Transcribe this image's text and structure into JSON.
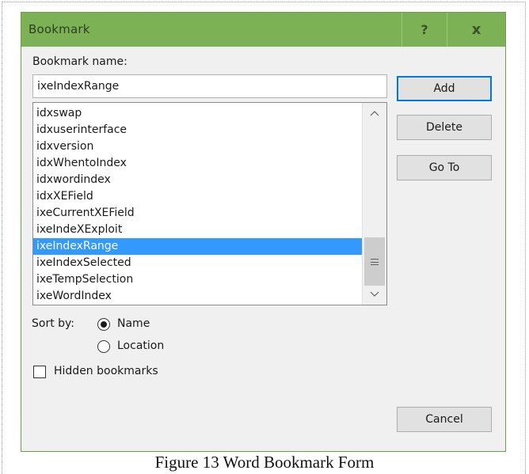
{
  "dialog": {
    "title": "Bookmark",
    "help_label": "?",
    "close_label": "x"
  },
  "bookmark_name_label": "Bookmark name:",
  "bookmark_name_value": "ixeIndexRange",
  "bookmarks": [
    "idxswap",
    "idxuserinterface",
    "idxversion",
    "idxWhentoIndex",
    "idxwordindex",
    "idxXEField",
    "ixeCurrentXEField",
    "ixeIndeXExploit",
    "ixeIndexRange",
    "ixeIndexSelected",
    "ixeTempSelection",
    "ixeWordIndex"
  ],
  "selected_bookmark": "ixeIndexRange",
  "buttons": {
    "add": "Add",
    "delete": "Delete",
    "goto": "Go To",
    "cancel": "Cancel"
  },
  "sort": {
    "label": "Sort by:",
    "options": [
      "Name",
      "Location"
    ],
    "selected": "Name"
  },
  "hidden_bookmarks": {
    "label": "Hidden bookmarks",
    "checked": false
  },
  "caption": "Figure 13 Word Bookmark Form",
  "colors": {
    "titlebar": "#7cb255",
    "selection": "#3399ff",
    "default_button_border": "#0078d7"
  },
  "icons": {
    "scroll_up": "chevron-up-icon",
    "scroll_down": "chevron-down-icon",
    "scroll_thumb_grip": "grip-icon"
  }
}
